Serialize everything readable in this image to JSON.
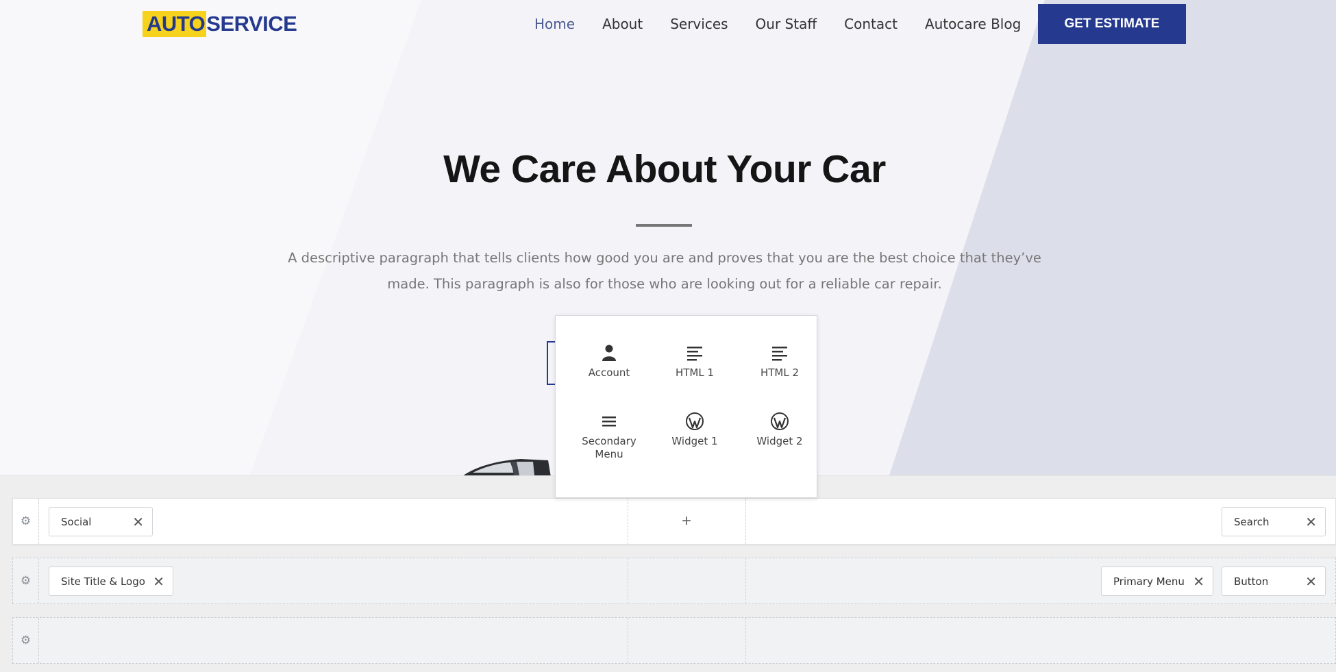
{
  "site": {
    "logo": {
      "part1": "AUTO",
      "part2": "SERVICE"
    },
    "nav": [
      {
        "label": "Home",
        "active": true
      },
      {
        "label": "About",
        "active": false
      },
      {
        "label": "Services",
        "active": false
      },
      {
        "label": "Our Staff",
        "active": false
      },
      {
        "label": "Contact",
        "active": false
      },
      {
        "label": "Autocare Blog",
        "active": false
      }
    ],
    "cta_label": "GET ESTIMATE",
    "hero": {
      "title": "We Care About Your Car",
      "text": "A descriptive paragraph that tells clients how good you are and proves that you are the best choice that they’ve made. This paragraph is also for those who are looking out for a reliable car repair."
    }
  },
  "popup": {
    "items": [
      {
        "label": "Account",
        "icon": "user-icon"
      },
      {
        "label": "HTML 1",
        "icon": "html-icon"
      },
      {
        "label": "HTML 2",
        "icon": "html-icon"
      },
      {
        "label": "Secondary Menu",
        "icon": "menu-icon"
      },
      {
        "label": "Widget 1",
        "icon": "wordpress-icon"
      },
      {
        "label": "Widget 2",
        "icon": "wordpress-icon"
      }
    ]
  },
  "builder": {
    "rows": [
      {
        "left": [
          "Social"
        ],
        "center": "+",
        "right": [
          "Search"
        ]
      },
      {
        "left": [
          "Site Title & Logo"
        ],
        "center": "",
        "right": [
          "Primary Menu",
          "Button"
        ]
      },
      {
        "left": [],
        "center": "",
        "right": []
      }
    ],
    "remove_glyph": "✕",
    "gear_glyph": "⚙"
  },
  "colors": {
    "brand": "#253a8e",
    "logo_yellow": "#f7d21c"
  }
}
